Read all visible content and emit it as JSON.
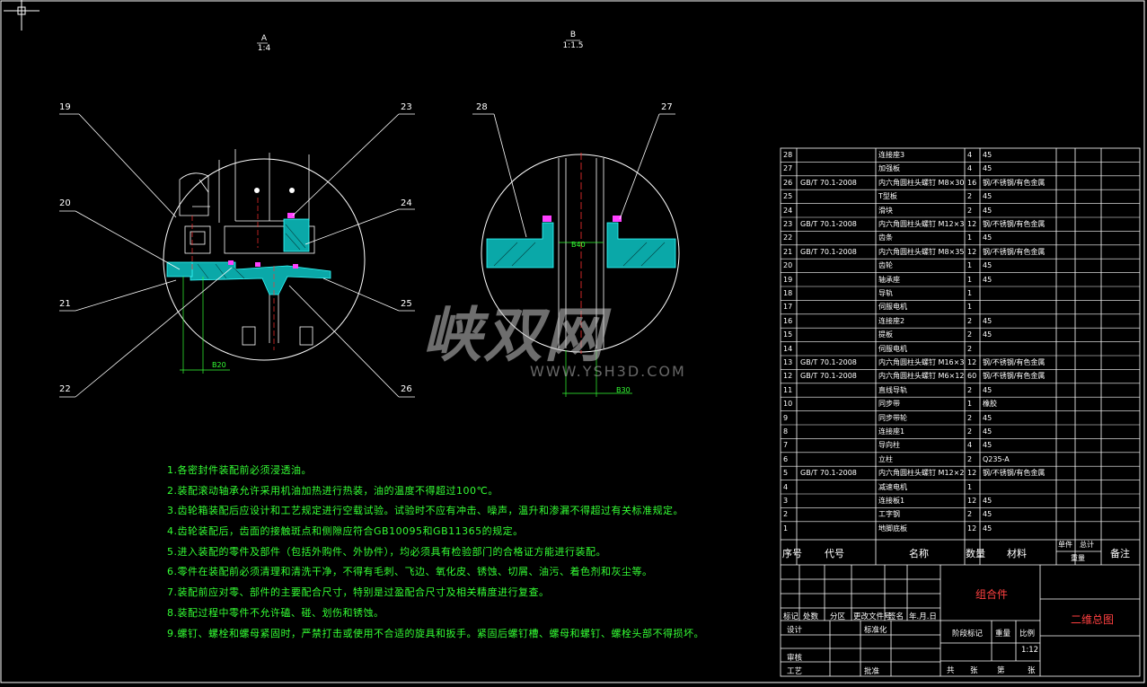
{
  "views": {
    "a": {
      "label": "A",
      "scale": "1:4"
    },
    "b": {
      "label": "B",
      "scale": "1:1.5"
    }
  },
  "callouts": {
    "c19": "19",
    "c20": "20",
    "c21": "21",
    "c22": "22",
    "c23": "23",
    "c24": "24",
    "c25": "25",
    "c26": "26",
    "c27": "27",
    "c28": "28"
  },
  "dimensions": {
    "d1": "B20",
    "d2": "B40",
    "d3": "B30"
  },
  "watermark": {
    "brand": "峡双网",
    "url": "WWW.YSH3D.COM"
  },
  "notes": [
    "1.各密封件装配前必须浸透油。",
    "2.装配滚动轴承允许采用机油加热进行热装，油的温度不得超过100℃。",
    "3.齿轮箱装配后应设计和工艺规定进行空载试验。试验时不应有冲击、噪声，温升和渗漏不得超过有关标准规定。",
    "4.齿轮装配后，齿面的接触斑点和侧隙应符合GB10095和GB11365的规定。",
    "5.进入装配的零件及部件（包括外购件、外协件），均必须具有检验部门的合格证方能进行装配。",
    "6.零件在装配前必须清理和清洗干净，不得有毛刺、飞边、氧化皮、锈蚀、切屑、油污、着色剂和灰尘等。",
    "7.装配前应对零、部件的主要配合尺寸，特别是过盈配合尺寸及相关精度进行复查。",
    "8.装配过程中零件不允许磕、碰、划伤和锈蚀。",
    "9.螺钉、螺栓和螺母紧固时，严禁打击或使用不合适的旋具和扳手。紧固后螺钉槽、螺母和螺钉、螺栓头部不得损坏。"
  ],
  "bom": [
    {
      "no": "28",
      "code": "",
      "name": "连接座3",
      "qty": "4",
      "mat": "45"
    },
    {
      "no": "27",
      "code": "",
      "name": "加强板",
      "qty": "4",
      "mat": "45"
    },
    {
      "no": "26",
      "code": "GB/T 70.1-2008",
      "name": "内六角圆柱头螺钉 M8×30",
      "qty": "16",
      "mat": "钢/不锈钢/有色金属"
    },
    {
      "no": "25",
      "code": "",
      "name": "T型板",
      "qty": "2",
      "mat": "45"
    },
    {
      "no": "24",
      "code": "",
      "name": "滑块",
      "qty": "2",
      "mat": "45"
    },
    {
      "no": "23",
      "code": "GB/T 70.1-2008",
      "name": "内六角圆柱头螺钉 M12×30",
      "qty": "12",
      "mat": "钢/不锈钢/有色金属"
    },
    {
      "no": "22",
      "code": "",
      "name": "齿条",
      "qty": "1",
      "mat": "45"
    },
    {
      "no": "21",
      "code": "GB/T 70.1-2008",
      "name": "内六角圆柱头螺钉 M8×35",
      "qty": "12",
      "mat": "钢/不锈钢/有色金属"
    },
    {
      "no": "20",
      "code": "",
      "name": "齿轮",
      "qty": "1",
      "mat": "45"
    },
    {
      "no": "19",
      "code": "",
      "name": "轴承座",
      "qty": "1",
      "mat": "45"
    },
    {
      "no": "18",
      "code": "",
      "name": "导轨",
      "qty": "1",
      "mat": ""
    },
    {
      "no": "17",
      "code": "",
      "name": "伺服电机",
      "qty": "1",
      "mat": ""
    },
    {
      "no": "16",
      "code": "",
      "name": "连接座2",
      "qty": "2",
      "mat": "45"
    },
    {
      "no": "15",
      "code": "",
      "name": "提板",
      "qty": "2",
      "mat": "45"
    },
    {
      "no": "14",
      "code": "",
      "name": "伺服电机",
      "qty": "2",
      "mat": ""
    },
    {
      "no": "13",
      "code": "GB/T 70.1-2008",
      "name": "内六角圆柱头螺钉 M16×30",
      "qty": "12",
      "mat": "钢/不锈钢/有色金属"
    },
    {
      "no": "12",
      "code": "GB/T 70.1-2008",
      "name": "内六角圆柱头螺钉 M6×12",
      "qty": "60",
      "mat": "钢/不锈钢/有色金属"
    },
    {
      "no": "11",
      "code": "",
      "name": "直线导轨",
      "qty": "2",
      "mat": "45"
    },
    {
      "no": "10",
      "code": "",
      "name": "同步带",
      "qty": "1",
      "mat": "橡胶"
    },
    {
      "no": "9",
      "code": "",
      "name": "同步带轮",
      "qty": "2",
      "mat": "45"
    },
    {
      "no": "8",
      "code": "",
      "name": "连接座1",
      "qty": "2",
      "mat": "45"
    },
    {
      "no": "7",
      "code": "",
      "name": "导向柱",
      "qty": "4",
      "mat": "45"
    },
    {
      "no": "6",
      "code": "",
      "name": "立柱",
      "qty": "2",
      "mat": "Q235-A"
    },
    {
      "no": "5",
      "code": "GB/T 70.1-2008",
      "name": "内六角圆柱头螺钉 M12×25",
      "qty": "12",
      "mat": "钢/不锈钢/有色金属"
    },
    {
      "no": "4",
      "code": "",
      "name": "减速电机",
      "qty": "1",
      "mat": ""
    },
    {
      "no": "3",
      "code": "",
      "name": "连接板1",
      "qty": "12",
      "mat": "45"
    },
    {
      "no": "2",
      "code": "",
      "name": "工字钢",
      "qty": "2",
      "mat": "45"
    },
    {
      "no": "1",
      "code": "",
      "name": "地脚底板",
      "qty": "12",
      "mat": "45"
    }
  ],
  "bom_header": {
    "no": "序号",
    "code": "代号",
    "name": "名称",
    "qty": "数量",
    "mat": "材料",
    "single": "单件",
    "total": "总计",
    "weight": "重量",
    "remark": "备注"
  },
  "title_block": {
    "mark": "标记",
    "count": "处数",
    "zone": "分区",
    "docno": "更改文件号",
    "sign": "签名",
    "date": "年.月.日",
    "design": "设计",
    "std": "标准化",
    "review": "审核",
    "process": "工艺",
    "approve": "批准",
    "stage_mark": "阶段标记",
    "weight": "重量",
    "scale": "比例",
    "scale_value": "1:12",
    "total_sheets": "共",
    "sheet": "张",
    "page": "第",
    "sheet2": "张",
    "part_name": "组合件",
    "drawing_title": "二维总图"
  }
}
